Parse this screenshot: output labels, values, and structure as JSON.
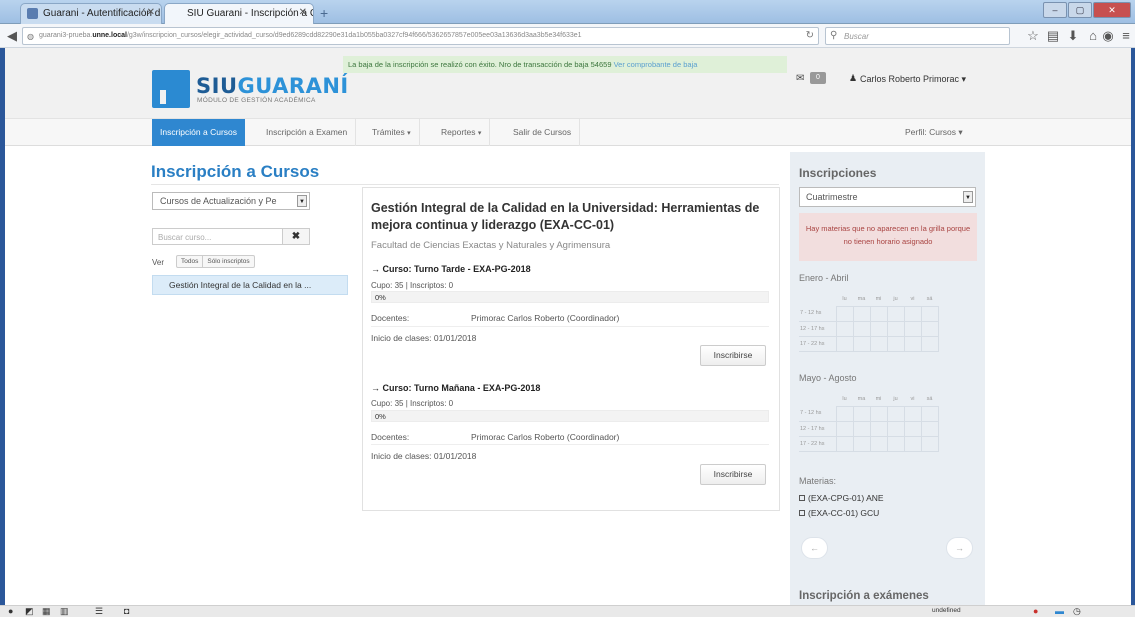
{
  "browser": {
    "tabs": [
      {
        "label": "Guarani - Autentificación d...",
        "active": false
      },
      {
        "label": "SIU Guarani - Inscripción a Cur...",
        "active": true
      }
    ],
    "new_tab": "+",
    "url_prefix": "guarani3-prueba.",
    "url_host": "unne.local",
    "url_path": "/g3w/inscripcion_cursos/elegir_actividad_curso/d9ed6289cdd82290e31da1b055ba0327cf94f666/5362657857e005ee03a13636d3aa3b5e34f633e1",
    "search_placeholder": "Buscar",
    "window_controls": {
      "minimize": "–",
      "maximize": "▢",
      "close": "✕"
    }
  },
  "header": {
    "logo_part1": "SIU",
    "logo_part2": "GUARANÍ",
    "logo_subtitle": "MÓDULO DE GESTIÓN ACADÉMICA",
    "flash_message": "La baja de la inscripción se realizó con éxito. Nro de transacción de baja 54659 ",
    "flash_link": "Ver comprobante de baja",
    "message_count": "0",
    "user_name": "Carlos Roberto Primorac"
  },
  "menu": {
    "items": [
      {
        "label": "Inscripción a Cursos",
        "active": true,
        "caret": false
      },
      {
        "label": "Inscripción a Examen",
        "active": false,
        "caret": false
      },
      {
        "label": "Trámites",
        "active": false,
        "caret": true
      },
      {
        "label": "Reportes",
        "active": false,
        "caret": true
      },
      {
        "label": "Salir de Cursos",
        "active": false,
        "caret": false
      }
    ],
    "perfil": "Perfil: Cursos"
  },
  "left": {
    "page_title": "Inscripción a Cursos",
    "select_value": "Cursos de Actualización y Pe",
    "search_placeholder": "Buscar curso...",
    "ver_label": "Ver",
    "filter_todos": "Todos",
    "filter_solo": "Sólo inscriptos",
    "course_item": "Gestión Integral de la Calidad en la ..."
  },
  "main": {
    "title": "Gestión Integral de la Calidad en la Universidad: Herramientas de mejora continua y liderazgo (EXA-CC-01)",
    "facultad": "Facultad de Ciencias Exactas y Naturales y Agrimensura",
    "courses": [
      {
        "heading": "→ Curso: Turno Tarde - EXA-PG-2018",
        "cupo": "Cupo: 35 | Inscriptos: 0",
        "progress_text": "0%",
        "progress": 0,
        "docentes_label": "Docentes:",
        "docentes_value": "Primorac Carlos Roberto (Coordinador)",
        "inicio": "Inicio de clases: 01/01/2018",
        "button": "Inscribirse"
      },
      {
        "heading": "→ Curso: Turno Mañana - EXA-PG-2018",
        "cupo": "Cupo: 35 | Inscriptos: 0",
        "progress_text": "0%",
        "progress": 0,
        "docentes_label": "Docentes:",
        "docentes_value": "Primorac Carlos Roberto (Coordinador)",
        "inicio": "Inicio de clases: 01/01/2018",
        "button": "Inscribirse"
      }
    ]
  },
  "sidebar": {
    "title": "Inscripciones",
    "select_value": "Cuatrimestre",
    "alert": "Hay materias que no aparecen en la grilla porque no tienen horario asignado",
    "periods": [
      {
        "label": "Enero - Abril"
      },
      {
        "label": "Mayo - Agosto"
      }
    ],
    "days": [
      "lu",
      "ma",
      "mi",
      "ju",
      "vi",
      "sá"
    ],
    "slots": [
      "7 - 12 hs",
      "12 - 17 hs",
      "17 - 22 hs"
    ],
    "materias_label": "Materias:",
    "materias": [
      "(EXA-CPG-01) ANE",
      "(EXA-CC-01) GCU"
    ],
    "prev": "←",
    "next": "→",
    "exam_title": "Inscripción a exámenes"
  },
  "statusbar": {
    "status_text": "undefined"
  },
  "colors": {
    "brand_blue": "#2a7fc4",
    "menu_active": "#2f87d0",
    "success_bg": "#dff0d8",
    "alert_bg": "#f2dede"
  }
}
